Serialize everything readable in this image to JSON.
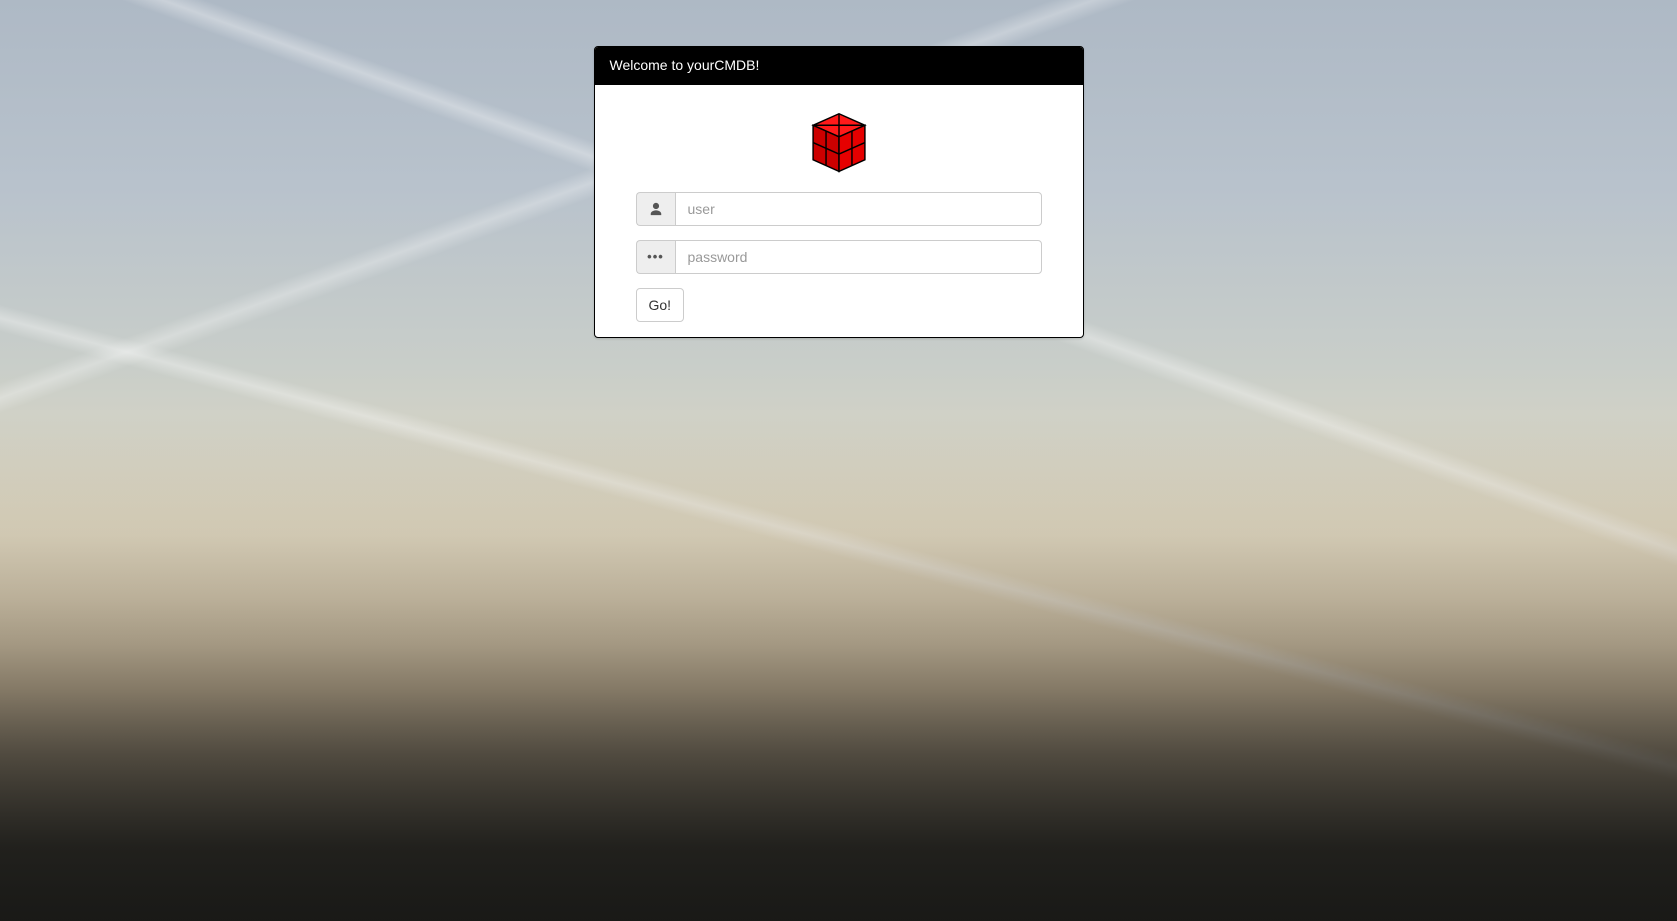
{
  "panel": {
    "title": "Welcome to yourCMDB!"
  },
  "form": {
    "user": {
      "placeholder": "user",
      "value": ""
    },
    "password": {
      "placeholder": "password",
      "value": ""
    },
    "submit_label": "Go!"
  },
  "logo": {
    "name": "cube-logo",
    "color": "#e60000"
  }
}
